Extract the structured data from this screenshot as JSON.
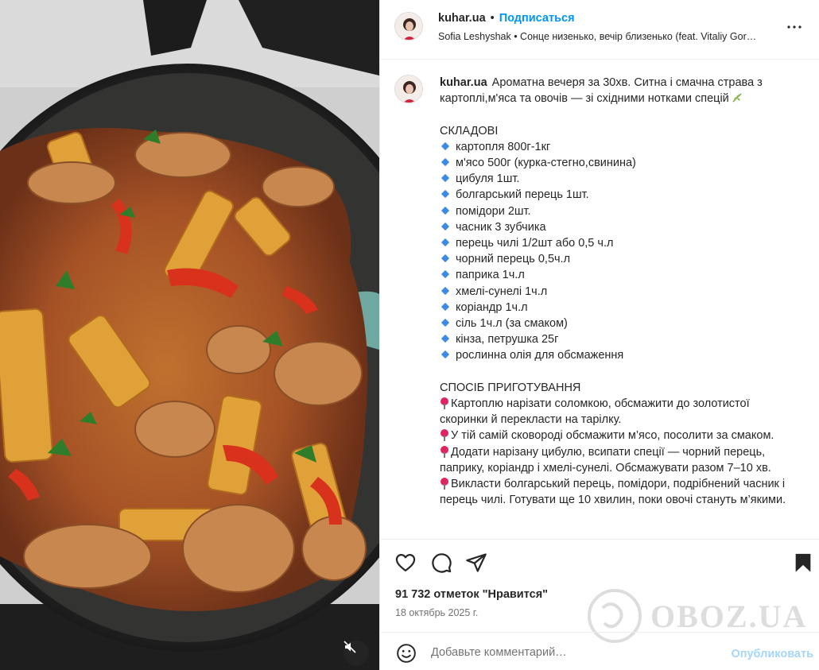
{
  "post": {
    "username": "kuhar.ua",
    "follow_label": "Подписаться",
    "separator": "•",
    "audio": "Sofia Leshyshak • Сонце низенько, вечір близенько (feat. Vitaliy Gor…"
  },
  "caption": {
    "username": "kuhar.ua",
    "intro": "Ароматна вечеря за 30хв. Ситна і смачна страва з картоплі,м'яса та овочів — зі східними нотками спецій",
    "ingredients_title": "СКЛАДОВІ",
    "ingredients": [
      "картопля 800г-1кг",
      "м'ясо 500г (курка-стегно,свинина)",
      "цибуля 1шт.",
      "болгарський перець 1шт.",
      "помідори 2шт.",
      "часник 3 зубчика",
      "перець чилі 1/2шт або 0,5 ч.л",
      "чорний перець 0,5ч.л",
      "паприка 1ч.л",
      "хмелі-сунелі 1ч.л",
      "коріандр 1ч.л",
      "сіль 1ч.л (за смаком)",
      "кінза, петрушка 25г",
      "рослинна олія для обсмаження"
    ],
    "method_title": "СПОСІБ ПРИГОТУВАННЯ",
    "steps": [
      "Картоплю нарізати соломкою, обсмажити до золотистої скоринки й перекласти на тарілку.",
      "У тій самій сковороді обсмажити м’ясо, посолити за смаком.",
      "Додати нарізану цибулю, всипати спеції — чорний перець, паприку, коріандр і хмелі-сунелі. Обсмажувати разом 7–10 хв.",
      "Викласти болгарський перець, помідори, подрібнений часник і перець чилі. Готувати ще 10 хвилин, поки овочі стануть м’якими."
    ]
  },
  "stats": {
    "likes": "91 732 отметок \"Нравится\"",
    "date": "18 октябрь 2025 г."
  },
  "comment": {
    "placeholder": "Добавьте комментарий…",
    "publish_label": "Опубликовать"
  },
  "watermark": {
    "text": "OBOZ.UA"
  },
  "icons": {
    "like": "heart-icon",
    "comment": "comment-icon",
    "share": "share-icon",
    "save": "bookmark-icon",
    "more": "more-icon",
    "emoji": "emoji-icon",
    "mute": "mute-icon"
  },
  "colors": {
    "follow": "#0095f6",
    "publish_disabled": "#a6d5fa",
    "bullet": "#3d8be0",
    "pin": "#e0245e"
  }
}
